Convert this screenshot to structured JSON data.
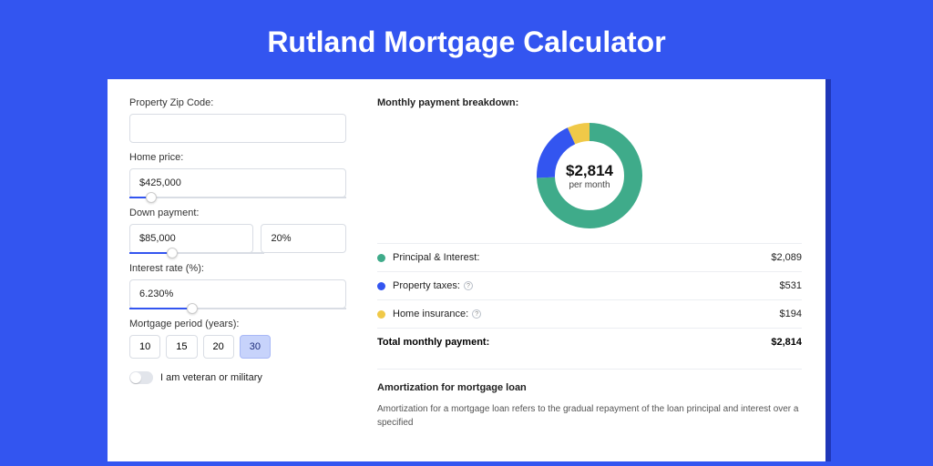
{
  "title": "Rutland Mortgage Calculator",
  "colors": {
    "pi": "#3fab8a",
    "tax": "#3355f0",
    "ins": "#f0c948"
  },
  "form": {
    "zip": {
      "label": "Property Zip Code:",
      "value": ""
    },
    "price": {
      "label": "Home price:",
      "value": "$425,000",
      "slider_pct": 10
    },
    "down": {
      "label": "Down payment:",
      "amount": "$85,000",
      "pct": "20%",
      "slider_pct": 20
    },
    "rate": {
      "label": "Interest rate (%):",
      "value": "6.230%",
      "slider_pct": 29
    },
    "period": {
      "label": "Mortgage period (years):",
      "options": [
        "10",
        "15",
        "20",
        "30"
      ],
      "active": "30"
    },
    "veteran": {
      "label": "I am veteran or military",
      "on": false
    }
  },
  "breakdown": {
    "heading": "Monthly payment breakdown:",
    "center_value": "$2,814",
    "center_sub": "per month",
    "items": [
      {
        "key": "pi",
        "label": "Principal & Interest:",
        "amount": "$2,089",
        "info": false
      },
      {
        "key": "tax",
        "label": "Property taxes:",
        "amount": "$531",
        "info": true
      },
      {
        "key": "ins",
        "label": "Home insurance:",
        "amount": "$194",
        "info": true
      }
    ],
    "total_label": "Total monthly payment:",
    "total_amount": "$2,814"
  },
  "chart_data": {
    "type": "pie",
    "title": "Monthly payment breakdown",
    "series": [
      {
        "name": "Principal & Interest",
        "value": 2089,
        "color": "#3fab8a"
      },
      {
        "name": "Property taxes",
        "value": 531,
        "color": "#3355f0"
      },
      {
        "name": "Home insurance",
        "value": 194,
        "color": "#f0c948"
      }
    ],
    "total": 2814
  },
  "amort": {
    "heading": "Amortization for mortgage loan",
    "body": "Amortization for a mortgage loan refers to the gradual repayment of the loan principal and interest over a specified"
  }
}
